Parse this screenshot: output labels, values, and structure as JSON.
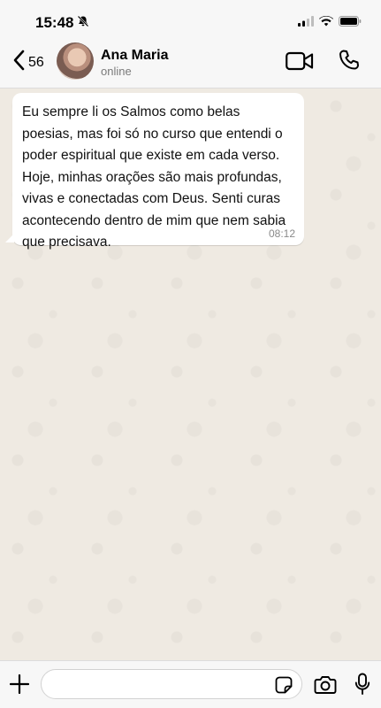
{
  "status_bar": {
    "time": "15:48",
    "icons": [
      "bell-slash-icon",
      "signal-icon",
      "wifi-icon",
      "battery-icon"
    ]
  },
  "header": {
    "back_count": "56",
    "contact_name": "Ana Maria",
    "contact_status": "online",
    "icons": [
      "chevron-left-icon",
      "video-icon",
      "phone-icon"
    ]
  },
  "chat": {
    "messages": [
      {
        "text": "Eu sempre li os Salmos como belas poesias, mas foi só no curso que entendi o poder espiritual que existe em cada verso. Hoje, minhas orações são mais profundas, vivas e conectadas com Deus. Senti curas acontecendo dentro de mim que nem sabia que precisava.",
        "time": "08:12",
        "direction": "incoming"
      }
    ]
  },
  "composer": {
    "input_value": "",
    "icons": [
      "plus-icon",
      "sticker-icon",
      "camera-icon",
      "microphone-icon"
    ]
  },
  "colors": {
    "chat_background": "#efeae2",
    "bubble_incoming": "#ffffff",
    "bar_background": "#f7f7f7"
  }
}
